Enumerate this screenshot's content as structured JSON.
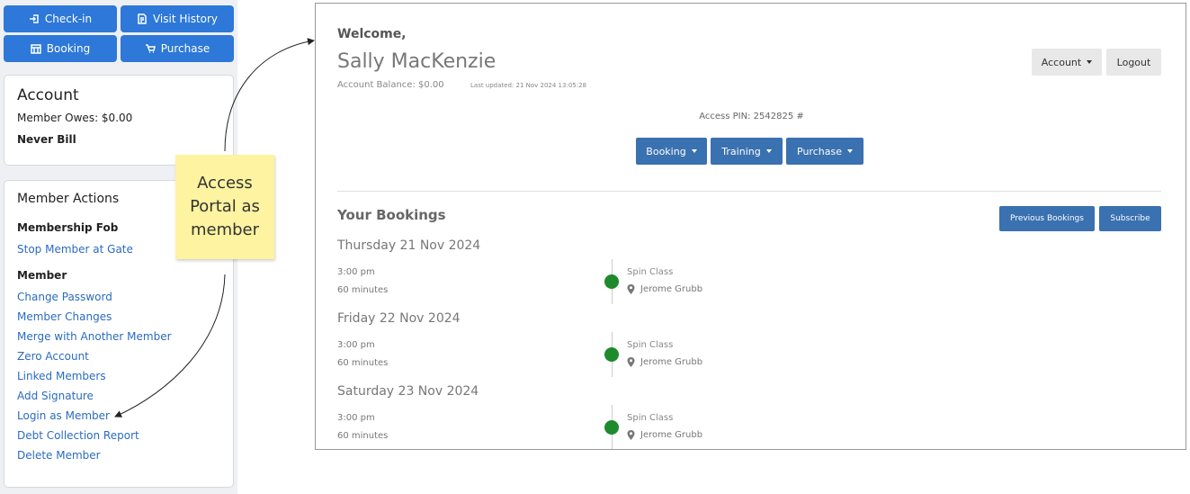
{
  "sidebar": {
    "buttons": {
      "checkin": "Check-in",
      "visit_history": "Visit History",
      "booking": "Booking",
      "purchase": "Purchase"
    },
    "account": {
      "title": "Account",
      "member_owes": "Member Owes: $0.00",
      "billing": "Never Bill"
    },
    "member_actions": {
      "title": "Member Actions",
      "fob_heading": "Membership Fob",
      "stop_gate": "Stop Member at Gate",
      "member_heading": "Member",
      "links": [
        "Change Password",
        "Member Changes",
        "Merge with Another Member",
        "Zero Account",
        "Linked Members",
        "Add Signature",
        "Login as Member",
        "Debt Collection Report",
        "Delete Member"
      ]
    }
  },
  "annotation": {
    "line1": "Access",
    "line2": "Portal as",
    "line3": "member"
  },
  "portal": {
    "welcome": "Welcome,",
    "name": "Sally MacKenzie",
    "balance": "Account Balance: $0.00",
    "updated": "Last updated: 21 Nov 2024 13:05:28",
    "account_btn": "Account",
    "logout_btn": "Logout",
    "access_pin": "Access PIN: 2542825 #",
    "menu": {
      "booking": "Booking",
      "training": "Training",
      "purchase": "Purchase"
    },
    "bookings_title": "Your Bookings",
    "previous_btn": "Previous Bookings",
    "subscribe_btn": "Subscribe",
    "bookings": [
      {
        "date": "Thursday 21 Nov 2024",
        "time": "3:00 pm",
        "duration": "60 minutes",
        "class": "Spin Class",
        "trainer": "Jerome Grubb"
      },
      {
        "date": "Friday 22 Nov 2024",
        "time": "3:00 pm",
        "duration": "60 minutes",
        "class": "Spin Class",
        "trainer": "Jerome Grubb"
      },
      {
        "date": "Saturday 23 Nov 2024",
        "time": "3:00 pm",
        "duration": "60 minutes",
        "class": "Spin Class",
        "trainer": "Jerome Grubb"
      }
    ]
  },
  "colors": {
    "primary_button": "#2d78d8",
    "portal_button": "#3a71b0",
    "link": "#2a6bc2",
    "status_dot": "#1e8a2c",
    "sticky_note": "#fdf3a0"
  }
}
